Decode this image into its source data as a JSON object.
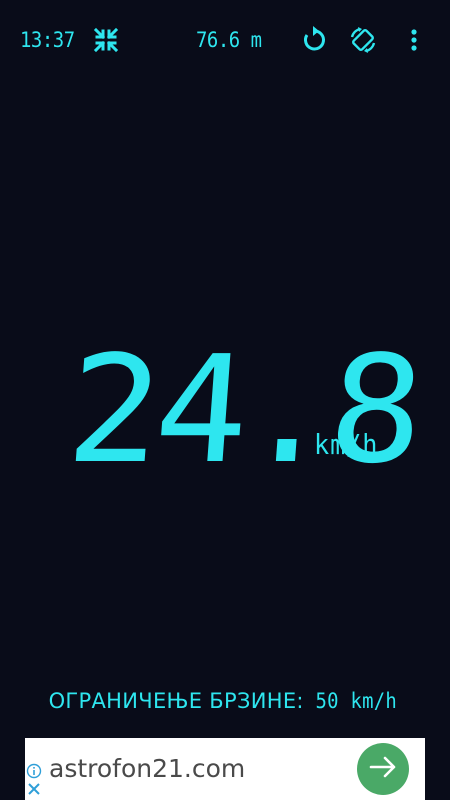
{
  "status": {
    "time": "13:37",
    "altitude": "76.6 m"
  },
  "icons": {
    "fullscreen": "fullscreen-exit-icon",
    "reset": "reset-icon",
    "rotate": "screen-rotation-icon",
    "menu": "more-vert-icon"
  },
  "speed": {
    "value": "24.8",
    "unit": "km/h"
  },
  "speed_limit": {
    "label": "ОГРАНИЧЕЊЕ БРЗИНЕ:",
    "value": "50 km/h"
  },
  "ad": {
    "text": "astrofon21.com"
  },
  "colors": {
    "background": "#090c19",
    "accent": "#2ee6ef",
    "ad_button": "#4aa967",
    "ad_text": "#4a4a4a"
  }
}
